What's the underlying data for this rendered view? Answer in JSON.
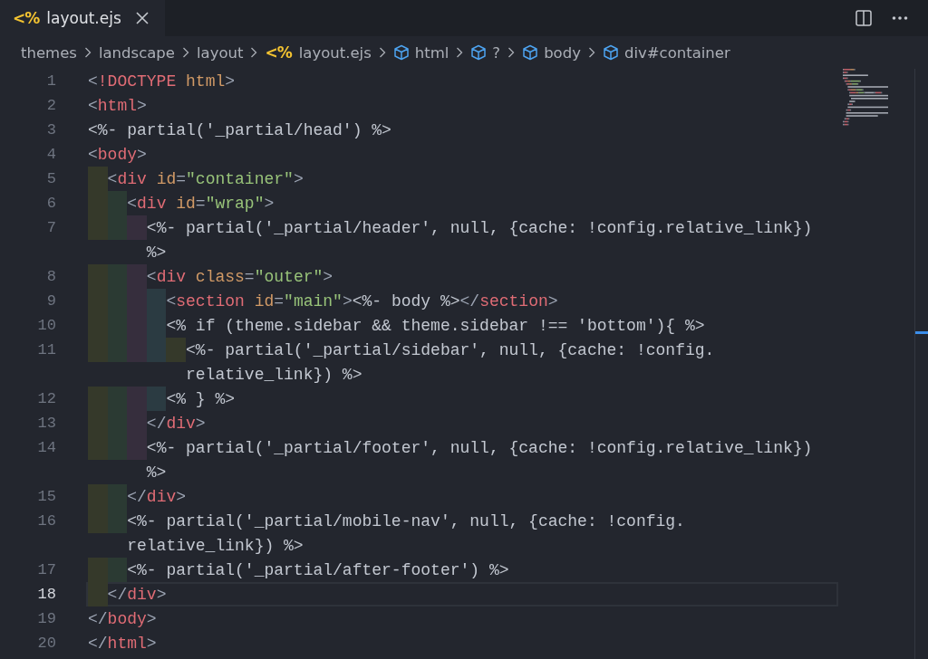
{
  "tab": {
    "icon": "<%",
    "label": "layout.ejs",
    "selected": true
  },
  "breadcrumb": [
    {
      "kind": "folder",
      "label": "themes"
    },
    {
      "kind": "folder",
      "label": "landscape"
    },
    {
      "kind": "folder",
      "label": "layout"
    },
    {
      "kind": "file",
      "icon": "<%",
      "label": "layout.ejs"
    },
    {
      "kind": "symbol",
      "label": "html"
    },
    {
      "kind": "symbol",
      "label": "?"
    },
    {
      "kind": "symbol",
      "label": "body"
    },
    {
      "kind": "symbol",
      "label": "div#container"
    }
  ],
  "lines": [
    {
      "number": "1",
      "current": false,
      "rows": [
        [
          {
            "kind": "punct",
            "text": "<"
          },
          {
            "kind": "tag",
            "text": "!DOCTYPE"
          },
          {
            "kind": "attr",
            "text": " html"
          },
          {
            "kind": "punct",
            "text": ">"
          }
        ]
      ]
    },
    {
      "number": "2",
      "current": false,
      "rows": [
        [
          {
            "kind": "punct",
            "text": "<"
          },
          {
            "kind": "tag",
            "text": "html"
          },
          {
            "kind": "punct",
            "text": ">"
          }
        ]
      ]
    },
    {
      "number": "3",
      "current": false,
      "rows": [
        [
          {
            "kind": "code",
            "text": "<%- partial('_partial/head') %>"
          }
        ]
      ]
    },
    {
      "number": "4",
      "current": false,
      "rows": [
        [
          {
            "kind": "punct",
            "text": "<"
          },
          {
            "kind": "tag",
            "text": "body"
          },
          {
            "kind": "punct",
            "text": ">"
          }
        ]
      ]
    },
    {
      "number": "5",
      "current": false,
      "rows": [
        [
          {
            "kind": "punct",
            "text": "  <"
          },
          {
            "kind": "tag",
            "text": "div"
          },
          {
            "kind": "attr",
            "text": " id"
          },
          {
            "kind": "punct",
            "text": "="
          },
          {
            "kind": "string",
            "text": "\"container\""
          },
          {
            "kind": "punct",
            "text": ">"
          }
        ]
      ]
    },
    {
      "number": "6",
      "current": false,
      "rows": [
        [
          {
            "kind": "punct",
            "text": "    <"
          },
          {
            "kind": "tag",
            "text": "div"
          },
          {
            "kind": "attr",
            "text": " id"
          },
          {
            "kind": "punct",
            "text": "="
          },
          {
            "kind": "string",
            "text": "\"wrap\""
          },
          {
            "kind": "punct",
            "text": ">"
          }
        ]
      ]
    },
    {
      "number": "7",
      "current": false,
      "rows": [
        [
          {
            "kind": "code",
            "text": "      <%- partial('_partial/header', null, {cache: !config.relative_link})"
          }
        ],
        [
          {
            "kind": "code",
            "text": "%>"
          }
        ]
      ]
    },
    {
      "number": "8",
      "current": false,
      "rows": [
        [
          {
            "kind": "punct",
            "text": "      <"
          },
          {
            "kind": "tag",
            "text": "div"
          },
          {
            "kind": "attr",
            "text": " class"
          },
          {
            "kind": "punct",
            "text": "="
          },
          {
            "kind": "string",
            "text": "\"outer\""
          },
          {
            "kind": "punct",
            "text": ">"
          }
        ]
      ]
    },
    {
      "number": "9",
      "current": false,
      "rows": [
        [
          {
            "kind": "punct",
            "text": "        <"
          },
          {
            "kind": "tag",
            "text": "section"
          },
          {
            "kind": "attr",
            "text": " id"
          },
          {
            "kind": "punct",
            "text": "="
          },
          {
            "kind": "string",
            "text": "\"main\""
          },
          {
            "kind": "punct",
            "text": ">"
          },
          {
            "kind": "code",
            "text": "<%- body %>"
          },
          {
            "kind": "punct",
            "text": "</"
          },
          {
            "kind": "tag",
            "text": "section"
          },
          {
            "kind": "punct",
            "text": ">"
          }
        ]
      ]
    },
    {
      "number": "10",
      "current": false,
      "rows": [
        [
          {
            "kind": "code",
            "text": "        <% if (theme.sidebar && theme.sidebar !== 'bottom'){ %>"
          }
        ]
      ]
    },
    {
      "number": "11",
      "current": false,
      "rows": [
        [
          {
            "kind": "code",
            "text": "          <%- partial('_partial/sidebar', null, {cache: !config."
          }
        ],
        [
          {
            "kind": "code",
            "text": "relative_link}) %>"
          }
        ]
      ]
    },
    {
      "number": "12",
      "current": false,
      "rows": [
        [
          {
            "kind": "code",
            "text": "        <% } %>"
          }
        ]
      ]
    },
    {
      "number": "13",
      "current": false,
      "rows": [
        [
          {
            "kind": "punct",
            "text": "      </"
          },
          {
            "kind": "tag",
            "text": "div"
          },
          {
            "kind": "punct",
            "text": ">"
          }
        ]
      ]
    },
    {
      "number": "14",
      "current": false,
      "rows": [
        [
          {
            "kind": "code",
            "text": "      <%- partial('_partial/footer', null, {cache: !config.relative_link})"
          }
        ],
        [
          {
            "kind": "code",
            "text": "%>"
          }
        ]
      ]
    },
    {
      "number": "15",
      "current": false,
      "rows": [
        [
          {
            "kind": "punct",
            "text": "    </"
          },
          {
            "kind": "tag",
            "text": "div"
          },
          {
            "kind": "punct",
            "text": ">"
          }
        ]
      ]
    },
    {
      "number": "16",
      "current": false,
      "rows": [
        [
          {
            "kind": "code",
            "text": "    <%- partial('_partial/mobile-nav', null, {cache: !config."
          }
        ],
        [
          {
            "kind": "code",
            "text": "relative_link}) %>"
          }
        ]
      ]
    },
    {
      "number": "17",
      "current": false,
      "rows": [
        [
          {
            "kind": "code",
            "text": "    <%- partial('_partial/after-footer') %>"
          }
        ]
      ]
    },
    {
      "number": "18",
      "current": true,
      "rows": [
        [
          {
            "kind": "punct",
            "text": "  </"
          },
          {
            "kind": "tag",
            "text": "div"
          },
          {
            "kind": "punct",
            "text": ">"
          }
        ]
      ]
    },
    {
      "number": "19",
      "current": false,
      "rows": [
        [
          {
            "kind": "punct",
            "text": "</"
          },
          {
            "kind": "tag",
            "text": "body"
          },
          {
            "kind": "punct",
            "text": ">"
          }
        ]
      ]
    },
    {
      "number": "20",
      "current": false,
      "rows": [
        [
          {
            "kind": "punct",
            "text": "</"
          },
          {
            "kind": "tag",
            "text": "html"
          },
          {
            "kind": "punct",
            "text": ">"
          }
        ]
      ]
    }
  ]
}
